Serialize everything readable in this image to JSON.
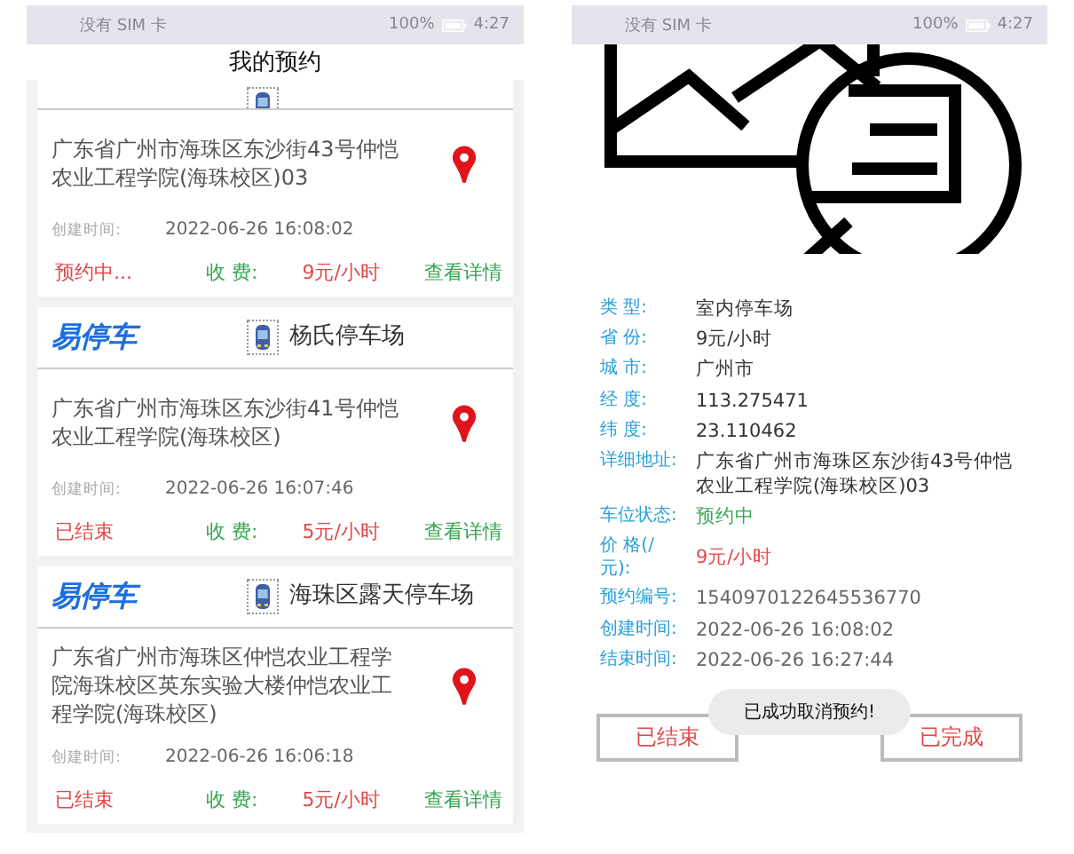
{
  "left_screen": {
    "status_bar": {
      "carrier": "没有 SIM 卡",
      "battery": "100%",
      "time": "4:27"
    },
    "title": "我的预约",
    "cards": [
      {
        "header_clipped": true,
        "address": "广东省广州市海珠区东沙街43号仲恺农业工程学院(海珠校区)03",
        "created_label": "创建时间:",
        "created": "2022-06-26 16:08:02",
        "status": "预约中...",
        "fee_label": "收 费:",
        "price": "9元/小时",
        "link": "查看详情"
      },
      {
        "header_clipped": false,
        "logo": "易停车",
        "lot_name": "杨氏停车场",
        "address": "广东省广州市海珠区东沙街41号仲恺农业工程学院(海珠校区)",
        "created_label": "创建时间:",
        "created": "2022-06-26 16:07:46",
        "status": "已结束",
        "fee_label": "收 费:",
        "price": "5元/小时",
        "link": "查看详情"
      },
      {
        "header_clipped": false,
        "logo": "易停车",
        "lot_name": "海珠区露天停车场",
        "address": "广东省广州市海珠区仲恺农业工程学院海珠校区英东实验大楼仲恺农业工程学院(海珠校区)",
        "created_label": "创建时间:",
        "created": "2022-06-26 16:06:18",
        "status": "已结束",
        "fee_label": "收 费:",
        "price": "5元/小时",
        "link": "查看详情"
      }
    ]
  },
  "right_screen": {
    "status_bar": {
      "carrier": "没有 SIM 卡",
      "battery": "100%",
      "time": "4:27"
    },
    "fields": [
      {
        "label": "类 型:",
        "value": "室内停车场",
        "kind": "plain"
      },
      {
        "label": "省 份:",
        "value": "9元/小时",
        "kind": "plain"
      },
      {
        "label": "城 市:",
        "value": "广州市",
        "kind": "plain"
      },
      {
        "label": "经 度:",
        "value": "113.275471",
        "kind": "plain"
      },
      {
        "label": "纬 度:",
        "value": "23.110462",
        "kind": "plain"
      },
      {
        "label": "详细地址:",
        "value": "广东省广州市海珠区东沙街43号仲恺农业工程学院(海珠校区)03",
        "kind": "plain"
      },
      {
        "label": "车位状态:",
        "value": "预约中",
        "kind": "status"
      },
      {
        "label": "价 格(/元):",
        "value": "9元/小时",
        "kind": "price"
      },
      {
        "label": "预约编号:",
        "value": "1540970122645536770",
        "kind": "muted"
      },
      {
        "label": "创建时间:",
        "value": "2022-06-26 16:08:02",
        "kind": "muted"
      },
      {
        "label": "结束时间:",
        "value": "2022-06-26 16:27:44",
        "kind": "muted"
      }
    ],
    "buttons": [
      "已结束",
      "已完成"
    ],
    "toast": "已成功取消预约!"
  }
}
